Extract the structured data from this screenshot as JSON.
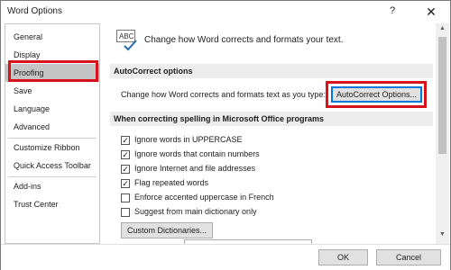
{
  "window": {
    "title": "Word Options",
    "help_label": "?",
    "close_label": "✕"
  },
  "sidebar": {
    "items": [
      {
        "label": "General"
      },
      {
        "label": "Display"
      },
      {
        "label": "Proofing"
      },
      {
        "label": "Save"
      },
      {
        "label": "Language"
      },
      {
        "label": "Advanced"
      },
      {
        "label": "Customize Ribbon"
      },
      {
        "label": "Quick Access Toolbar"
      },
      {
        "label": "Add-ins"
      },
      {
        "label": "Trust Center"
      }
    ],
    "selected": "Proofing"
  },
  "main": {
    "header_text": "Change how Word corrects and formats your text.",
    "autocorrect_section": {
      "title": "AutoCorrect options",
      "description": "Change how Word corrects and formats text as you type:",
      "button_label": "AutoCorrect Options..."
    },
    "spelling_section": {
      "title": "When correcting spelling in Microsoft Office programs",
      "options": [
        {
          "label": "Ignore words in UPPERCASE",
          "checked": "✓"
        },
        {
          "label": "Ignore words that contain numbers",
          "checked": "✓"
        },
        {
          "label": "Ignore Internet and file addresses",
          "checked": "✓"
        },
        {
          "label": "Flag repeated words",
          "checked": "✓"
        },
        {
          "label": "Enforce accented uppercase in French",
          "checked": ""
        },
        {
          "label": "Suggest from main dictionary only",
          "checked": ""
        }
      ],
      "custom_dictionaries_label": "Custom Dictionaries..."
    }
  },
  "footer": {
    "ok_label": "OK",
    "cancel_label": "Cancel"
  },
  "colors": {
    "highlight": "#d6131b",
    "selected_nav": "#c5c5c5",
    "section_bg": "#ededed"
  },
  "icons": {
    "abc": "abc-check-icon"
  }
}
